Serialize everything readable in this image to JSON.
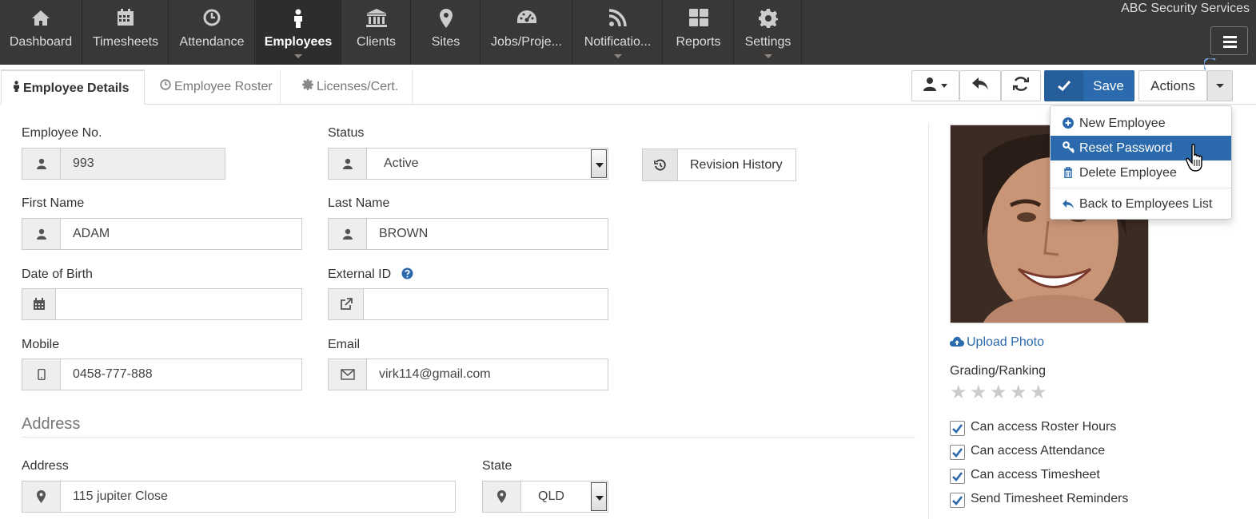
{
  "app": {
    "company": "ABC Security Services"
  },
  "nav": {
    "items": [
      {
        "label": "Dashboard",
        "icon": "home-icon"
      },
      {
        "label": "Timesheets",
        "icon": "calendar-icon"
      },
      {
        "label": "Attendance",
        "icon": "clock-icon"
      },
      {
        "label": "Employees",
        "icon": "person-icon"
      },
      {
        "label": "Clients",
        "icon": "bank-icon"
      },
      {
        "label": "Sites",
        "icon": "map-marker-icon"
      },
      {
        "label": "Jobs/Proje...",
        "icon": "dashboard-icon"
      },
      {
        "label": "Notificatio...",
        "icon": "rss-icon"
      },
      {
        "label": "Reports",
        "icon": "grid-icon"
      },
      {
        "label": "Settings",
        "icon": "gear-icon"
      }
    ],
    "active": "Employees"
  },
  "tabs": [
    {
      "label": "Employee Details",
      "icon": "person-icon"
    },
    {
      "label": "Employee Roster",
      "icon": "clock-icon"
    },
    {
      "label": "Licenses/Cert.",
      "icon": "certificate-icon"
    }
  ],
  "toolbar": {
    "save_label": "Save",
    "actions_label": "Actions"
  },
  "actions_menu": [
    {
      "label": "New Employee",
      "icon": "plus-circle-icon"
    },
    {
      "label": "Reset Password",
      "icon": "key-icon"
    },
    {
      "label": "Delete Employee",
      "icon": "trash-icon"
    },
    {
      "label": "Back to Employees List",
      "icon": "reply-icon"
    }
  ],
  "form": {
    "employee_no": {
      "label": "Employee No.",
      "value": "993"
    },
    "status": {
      "label": "Status",
      "value": "Active"
    },
    "revision_history": "Revision History",
    "first_name": {
      "label": "First Name",
      "value": "ADAM"
    },
    "last_name": {
      "label": "Last Name",
      "value": "BROWN"
    },
    "dob": {
      "label": "Date of Birth",
      "value": ""
    },
    "external_id": {
      "label": "External ID",
      "value": ""
    },
    "mobile": {
      "label": "Mobile",
      "value": "0458-777-888"
    },
    "email": {
      "label": "Email",
      "value": "virk114@gmail.com"
    },
    "address_section": "Address",
    "address": {
      "label": "Address",
      "value": "115 jupiter Close"
    },
    "state": {
      "label": "State",
      "value": "QLD"
    }
  },
  "side": {
    "upload_photo": "Upload Photo",
    "grading_label": "Grading/Ranking",
    "rating": 0,
    "rating_max": 5,
    "permissions": [
      {
        "label": "Can access Roster Hours",
        "checked": true
      },
      {
        "label": "Can access Attendance",
        "checked": true
      },
      {
        "label": "Can access Timesheet",
        "checked": true
      },
      {
        "label": "Send Timesheet Reminders",
        "checked": true
      }
    ]
  },
  "colors": {
    "accent": "#2b6aad",
    "nav_bg": "#3a3836"
  }
}
